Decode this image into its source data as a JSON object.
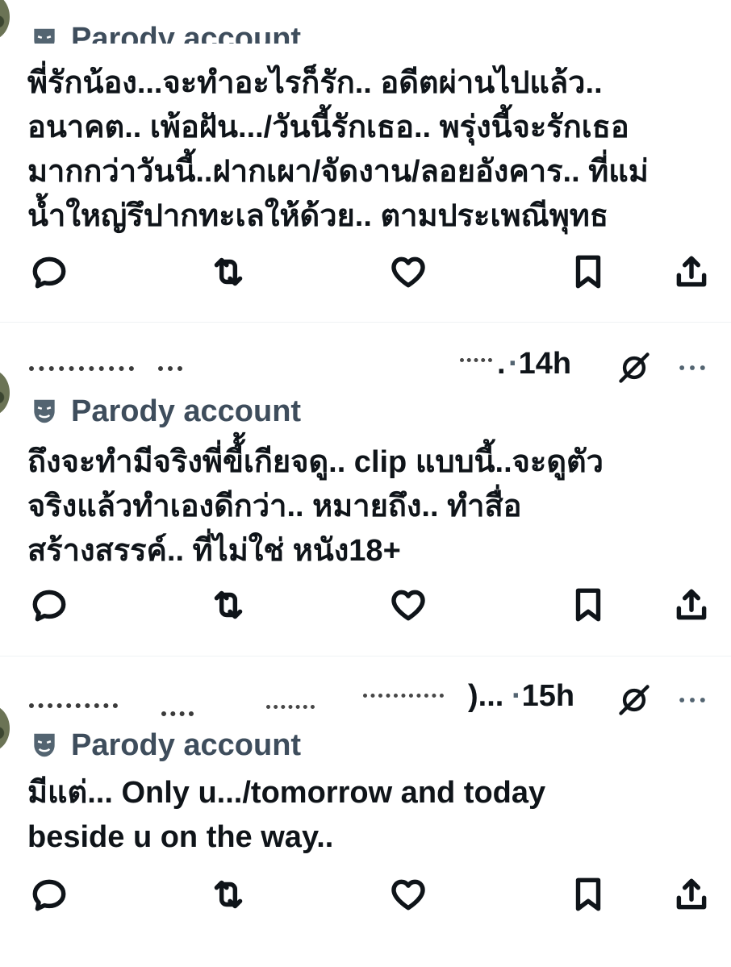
{
  "tweets": [
    {
      "parody_label": "Parody account",
      "text": "พี่รักน้อง...จะทำอะไรก็รัก.. อดีตผ่านไปแล้ว..\nอนาคต.. เพ้อฝัน.../วันนี้รักเธอ.. พรุ่งนี้จะรักเธอ\nมากกว่าวันนี้..ฝากเผา/จัดงาน/ลอยอังคาร.. ที่แม่\nน้ำใหญ่รึปากทะเลให้ด้วย.. ตามประเพณีพุทธ"
    },
    {
      "handle_tail": ".",
      "time": "14h",
      "time_sep": "·",
      "parody_label": "Parody account",
      "text": "ถึงจะทำมีจริงพี่ขี้้เกียจดู.. clip แบบนี้..จะดูตัว\nจริงแล้วทำเองดีกว่า.. หมายถึง.. ทำสื่อ\nสร้างสรรค์.. ที่ไม่ใช่ หนัง18+"
    },
    {
      "handle_tail": ")...",
      "time": "15h",
      "time_sep": "·",
      "parody_label": "Parody account",
      "text": "มีแต่... Only u.../tomorrow and today\nbeside u on the way.."
    }
  ],
  "icons": {
    "reply": "reply-icon",
    "repost": "repost-icon",
    "like": "heart-icon",
    "bookmark": "bookmark-icon",
    "share": "share-icon",
    "grok": "grok-icon",
    "more": "more-icon",
    "parody": "parody-mask-icon"
  },
  "colors": {
    "text": "#0f1419",
    "parody_label": "#3e4d5c",
    "divider": "#eff3f4",
    "muted": "#536471"
  }
}
